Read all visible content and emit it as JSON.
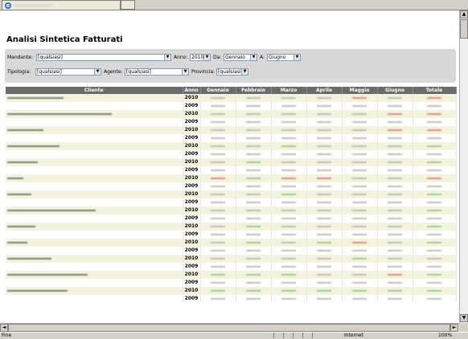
{
  "browser": {
    "status_text": "Fine",
    "zone_text": "Internet",
    "zoom_text": "100%"
  },
  "page": {
    "title": "Analisi Sintetica Fatturati"
  },
  "filters": {
    "mandante_label": "Mandante:",
    "mandante_value": "[qualsiasi]",
    "anno_label": "Anno:",
    "anno_value": "2010",
    "da_label": "Da:",
    "da_value": "Gennaio",
    "a_label": "A:",
    "a_value": "Giugno",
    "tipologia_label": "Tipologia:",
    "tipologia_value": "[qualsiasi]",
    "agente_label": "Agente:",
    "agente_value": "[qualsiasi]",
    "provincia_label": "Provincia:",
    "provincia_value": "[qualsiasi]"
  },
  "table": {
    "headers": [
      "Cliente",
      "Anno",
      "Gennaio",
      "Febbraio",
      "Marzo",
      "Aprile",
      "Maggio",
      "Giugno",
      "Totale"
    ],
    "rows": [
      {
        "anno": "2010",
        "name_w": 70,
        "colors": [
          "#bbb",
          "#bbb",
          "#bbb",
          "#bbb",
          "#e08a80",
          "#bbb",
          "#e08a80"
        ]
      },
      {
        "anno": "2009",
        "name_w": 0,
        "colors": [
          "#bbb",
          "#bbb",
          "#bbb",
          "#bbb",
          "#bbb",
          "#bbb",
          "#bbb"
        ]
      },
      {
        "anno": "2010",
        "name_w": 130,
        "colors": [
          "#bbb",
          "#bbb",
          "#bbb",
          "#bbb",
          "#bbb",
          "#e08a80",
          "#e08a80"
        ]
      },
      {
        "anno": "2009",
        "name_w": 0,
        "colors": [
          "#bbb",
          "#bbb",
          "#bbb",
          "#bbb",
          "#bbb",
          "#bbb",
          "#bbb"
        ]
      },
      {
        "anno": "2010",
        "name_w": 45,
        "colors": [
          "#bbb",
          "#bbb",
          "#bbb",
          "#bbb",
          "#bbb",
          "#e08a80",
          "#e08a80"
        ]
      },
      {
        "anno": "2009",
        "name_w": 0,
        "colors": [
          "#bbb",
          "#bbb",
          "#bbb",
          "#bbb",
          "#bbb",
          "#bbb",
          "#bbb"
        ]
      },
      {
        "anno": "2010",
        "name_w": 65,
        "colors": [
          "#bbb",
          "#bbb",
          "#9cc88c",
          "#bbb",
          "#bbb",
          "#bbb",
          "#9cc88c"
        ]
      },
      {
        "anno": "2009",
        "name_w": 0,
        "colors": [
          "#bbb",
          "#bbb",
          "#bbb",
          "#bbb",
          "#bbb",
          "#bbb",
          "#bbb"
        ]
      },
      {
        "anno": "2010",
        "name_w": 38,
        "colors": [
          "#bbb",
          "#9cc88c",
          "#bbb",
          "#bbb",
          "#bbb",
          "#bbb",
          "#9cc88c"
        ]
      },
      {
        "anno": "2009",
        "name_w": 0,
        "colors": [
          "#bbb",
          "#bbb",
          "#bbb",
          "#bbb",
          "#bbb",
          "#bbb",
          "#bbb"
        ]
      },
      {
        "anno": "2010",
        "name_w": 20,
        "colors": [
          "#e08a80",
          "#9cc88c",
          "#e08a80",
          "#e08a80",
          "#bbb",
          "#bbb",
          "#e08a80"
        ]
      },
      {
        "anno": "2009",
        "name_w": 0,
        "colors": [
          "#bbb",
          "#bbb",
          "#bbb",
          "#bbb",
          "#bbb",
          "#bbb",
          "#bbb"
        ]
      },
      {
        "anno": "2010",
        "name_w": 30,
        "colors": [
          "#bbb",
          "#bbb",
          "#9cc88c",
          "#bbb",
          "#bbb",
          "#bbb",
          "#9cc88c"
        ]
      },
      {
        "anno": "2009",
        "name_w": 0,
        "colors": [
          "#bbb",
          "#bbb",
          "#bbb",
          "#bbb",
          "#bbb",
          "#bbb",
          "#bbb"
        ]
      },
      {
        "anno": "2010",
        "name_w": 110,
        "colors": [
          "#bbb",
          "#bbb",
          "#bbb",
          "#bbb",
          "#bbb",
          "#bbb",
          "#9cc88c"
        ]
      },
      {
        "anno": "2009",
        "name_w": 0,
        "colors": [
          "#bbb",
          "#bbb",
          "#bbb",
          "#bbb",
          "#bbb",
          "#bbb",
          "#bbb"
        ]
      },
      {
        "anno": "2010",
        "name_w": 35,
        "colors": [
          "#bbb",
          "#9cc88c",
          "#bbb",
          "#bbb",
          "#bbb",
          "#bbb",
          "#9cc88c"
        ]
      },
      {
        "anno": "2009",
        "name_w": 0,
        "colors": [
          "#bbb",
          "#bbb",
          "#bbb",
          "#bbb",
          "#bbb",
          "#bbb",
          "#bbb"
        ]
      },
      {
        "anno": "2010",
        "name_w": 25,
        "colors": [
          "#bbb",
          "#9cc88c",
          "#bbb",
          "#9cc88c",
          "#e08a80",
          "#bbb",
          "#9cc88c"
        ]
      },
      {
        "anno": "2009",
        "name_w": 0,
        "colors": [
          "#bbb",
          "#bbb",
          "#bbb",
          "#bbb",
          "#bbb",
          "#bbb",
          "#bbb"
        ]
      },
      {
        "anno": "2010",
        "name_w": 55,
        "colors": [
          "#bbb",
          "#bbb",
          "#bbb",
          "#bbb",
          "#9cc88c",
          "#bbb",
          "#bbb"
        ]
      },
      {
        "anno": "2009",
        "name_w": 0,
        "colors": [
          "#bbb",
          "#bbb",
          "#bbb",
          "#bbb",
          "#bbb",
          "#bbb",
          "#bbb"
        ]
      },
      {
        "anno": "2010",
        "name_w": 100,
        "colors": [
          "#9cc88c",
          "#9cc88c",
          "#9cc88c",
          "#bbb",
          "#bbb",
          "#e08a80",
          "#9cc88c"
        ]
      },
      {
        "anno": "2009",
        "name_w": 0,
        "colors": [
          "#bbb",
          "#bbb",
          "#bbb",
          "#bbb",
          "#bbb",
          "#bbb",
          "#bbb"
        ]
      },
      {
        "anno": "2010",
        "name_w": 75,
        "colors": [
          "#9cc88c",
          "#9cc88c",
          "#9cc88c",
          "#9cc88c",
          "#9cc88c",
          "#9cc88c",
          "#9cc88c"
        ]
      },
      {
        "anno": "2009",
        "name_w": 0,
        "colors": [
          "#bbb",
          "#bbb",
          "#bbb",
          "#bbb",
          "#bbb",
          "#bbb",
          "#bbb"
        ]
      }
    ]
  }
}
